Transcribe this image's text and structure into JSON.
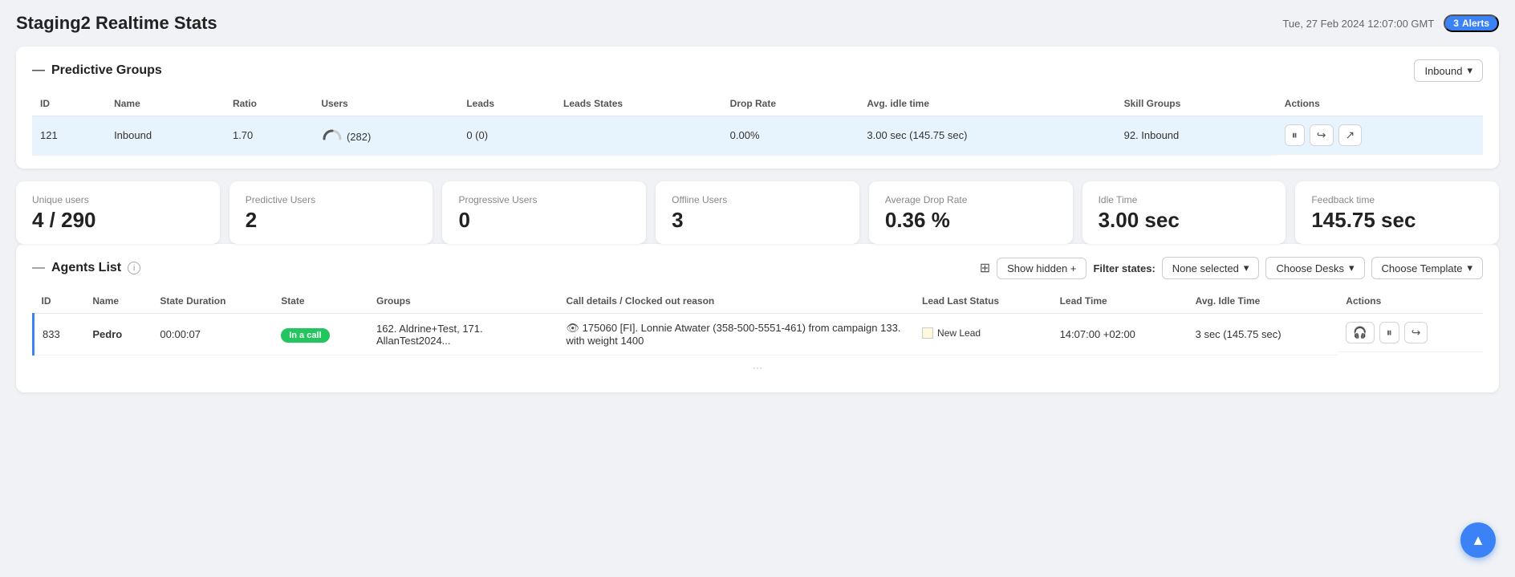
{
  "page": {
    "title": "Staging2 Realtime Stats",
    "datetime": "Tue, 27 Feb 2024 12:07:00 GMT",
    "alerts_count": "3",
    "alerts_label": "Alerts"
  },
  "predictive_groups": {
    "section_title": "Predictive Groups",
    "filter_value": "Inbound",
    "table_headers": [
      "ID",
      "Name",
      "Ratio",
      "Users",
      "Leads",
      "Leads States",
      "Drop Rate",
      "Avg. idle time",
      "Skill Groups",
      "Actions"
    ],
    "rows": [
      {
        "id": "121",
        "name": "Inbound",
        "ratio": "1.70",
        "users_display": "(282)",
        "leads": "0 (0)",
        "leads_states": "",
        "drop_rate": "0.00%",
        "avg_idle_time": "3.00 sec (145.75 sec)",
        "skill_groups": "92. Inbound"
      }
    ]
  },
  "stats": {
    "unique_users_label": "Unique users",
    "unique_users_value": "4 / 290",
    "predictive_users_label": "Predictive Users",
    "predictive_users_value": "2",
    "progressive_users_label": "Progressive Users",
    "progressive_users_value": "0",
    "offline_users_label": "Offline Users",
    "offline_users_value": "3",
    "avg_drop_rate_label": "Average Drop Rate",
    "avg_drop_rate_value": "0.36 %",
    "idle_time_label": "Idle Time",
    "idle_time_value": "3.00 sec",
    "feedback_time_label": "Feedback time",
    "feedback_time_value": "145.75 sec"
  },
  "agents_list": {
    "section_title": "Agents List",
    "show_hidden_label": "Show hidden +",
    "filter_states_label": "Filter states:",
    "none_selected_label": "None selected",
    "choose_desks_label": "Choose Desks",
    "choose_template_label": "Choose Template",
    "table_headers": [
      "ID",
      "Name",
      "State Duration",
      "State",
      "Groups",
      "Call details / Clocked out reason",
      "Lead Last Status",
      "Lead Time",
      "Avg. Idle Time",
      "Actions"
    ],
    "rows": [
      {
        "id": "833",
        "name": "Pedro",
        "state_duration": "00:00:07",
        "state": "In a call",
        "groups": "162. Aldrine+Test, 171. AllanTest2024...",
        "call_details": "175060 [FI]. Lonnie Atwater (358-500-5551-461) from campaign 133. with weight 1400",
        "lead_last_status": "New Lead",
        "lead_time": "14:07:00 +02:00",
        "avg_idle_time": "3 sec (145.75 sec)"
      }
    ]
  }
}
